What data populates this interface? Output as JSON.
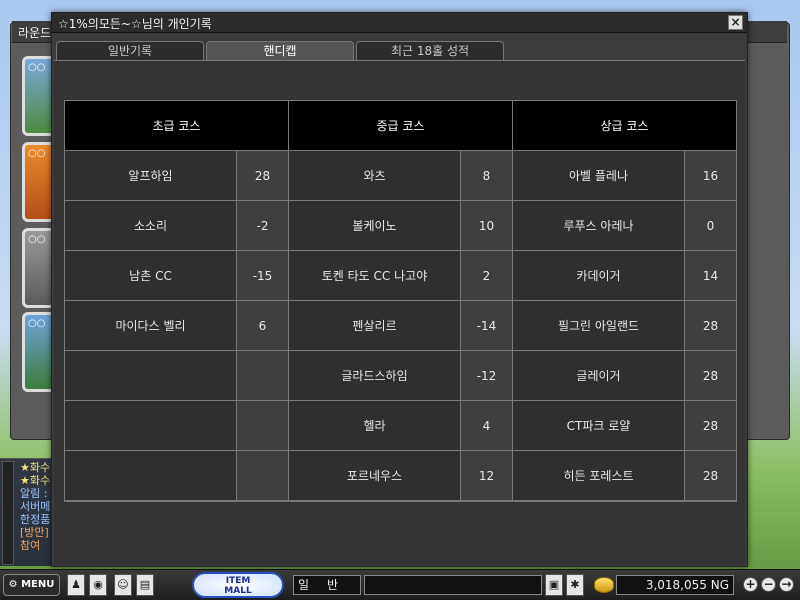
{
  "background": {
    "window_title": "라운드",
    "chat_lines": [
      {
        "text": "★화수",
        "color": "yellow"
      },
      {
        "text": "★화수",
        "color": "yellow"
      },
      {
        "text": "알림 :",
        "color": "blue"
      },
      {
        "text": "서버메",
        "color": "blue"
      },
      {
        "text": "한정품",
        "color": "blue"
      },
      {
        "text": "[방만]",
        "color": "orange"
      },
      {
        "text": "참여",
        "color": "orange"
      }
    ]
  },
  "dialog": {
    "title": "☆1%의모든~☆님의 개인기록",
    "close_label": "×",
    "tabs": [
      "일반기록",
      "핸디캡",
      "최근 18홀 성적"
    ],
    "active_tab": 1
  },
  "table": {
    "columns": [
      {
        "header": "초급 코스",
        "rows": [
          {
            "name": "알프하임",
            "value": "28"
          },
          {
            "name": "소소리",
            "value": "-2"
          },
          {
            "name": "남촌 CC",
            "value": "-15"
          },
          {
            "name": "마이다스 벨리",
            "value": "6"
          },
          {
            "name": "",
            "value": ""
          },
          {
            "name": "",
            "value": ""
          },
          {
            "name": "",
            "value": ""
          }
        ]
      },
      {
        "header": "중급 코스",
        "rows": [
          {
            "name": "와츠",
            "value": "8"
          },
          {
            "name": "볼케이노",
            "value": "10"
          },
          {
            "name": "토켄 타도 CC 나고야",
            "value": "2"
          },
          {
            "name": "펜살리르",
            "value": "-14"
          },
          {
            "name": "글라드스하임",
            "value": "-12"
          },
          {
            "name": "헬라",
            "value": "4"
          },
          {
            "name": "포르네우스",
            "value": "12"
          }
        ]
      },
      {
        "header": "상급 코스",
        "rows": [
          {
            "name": "아벨 플레나",
            "value": "16"
          },
          {
            "name": "루푸스 아레나",
            "value": "0"
          },
          {
            "name": "카데이거",
            "value": "14"
          },
          {
            "name": "필그린 아일랜드",
            "value": "28"
          },
          {
            "name": "글레이거",
            "value": "28"
          },
          {
            "name": "CT파크 로얄",
            "value": "28"
          },
          {
            "name": "히든 포레스트",
            "value": "28"
          }
        ]
      }
    ]
  },
  "bottombar": {
    "menu_label": "MENU",
    "itemmall_line1": "ITEM",
    "itemmall_line2": "MALL",
    "chat_mode": "일반",
    "chat_input_value": "",
    "ng_value": "3,018,055 NG",
    "plus_label": "+",
    "minus_label": "−",
    "arrow_label": "→"
  }
}
